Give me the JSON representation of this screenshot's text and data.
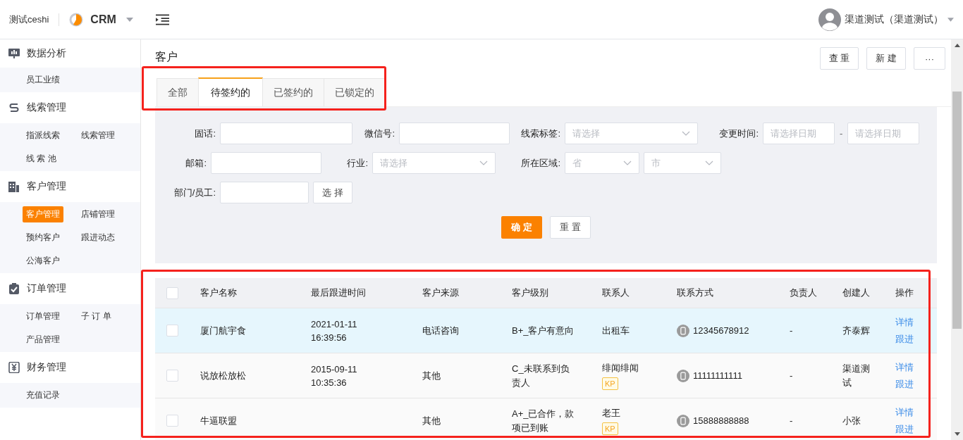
{
  "header": {
    "workspace": "测试ceshi",
    "app": "CRM",
    "user": "渠道测试（渠道测试）"
  },
  "sidebar": {
    "groups": [
      {
        "title": "数据分析",
        "items": [
          {
            "label": "员工业绩",
            "selected": false
          }
        ]
      },
      {
        "title": "线索管理",
        "items": [
          {
            "label": "指派线索",
            "selected": false
          },
          {
            "label": "线索管理",
            "selected": false
          },
          {
            "label": "线 索 池",
            "selected": false
          }
        ]
      },
      {
        "title": "客户管理",
        "items": [
          {
            "label": "客户管理",
            "selected": true
          },
          {
            "label": "店铺管理",
            "selected": false
          },
          {
            "label": "预约客户",
            "selected": false
          },
          {
            "label": "跟进动态",
            "selected": false
          },
          {
            "label": "公海客户",
            "selected": false
          }
        ]
      },
      {
        "title": "订单管理",
        "items": [
          {
            "label": "订单管理",
            "selected": false
          },
          {
            "label": "子 订 单",
            "selected": false
          },
          {
            "label": "产品管理",
            "selected": false
          }
        ]
      },
      {
        "title": "财务管理",
        "items": [
          {
            "label": "充值记录",
            "selected": false
          }
        ]
      }
    ]
  },
  "page": {
    "title": "客户",
    "buttons": [
      "查 重",
      "新 建",
      "···"
    ]
  },
  "tabs": [
    {
      "label": "全部",
      "selected": false
    },
    {
      "label": "待签约的",
      "selected": true
    },
    {
      "label": "已签约的",
      "selected": false
    },
    {
      "label": "已锁定的",
      "selected": false
    }
  ],
  "filters": {
    "rows": [
      [
        {
          "label": "固话:",
          "kind": "input"
        },
        {
          "label": "微信号:",
          "kind": "input"
        },
        {
          "label": "线索标签:",
          "kind": "select",
          "placeholder": "请选择"
        },
        {
          "label": "变更时间:",
          "kind": "date-range",
          "placeholder": "请选择日期",
          "placeholder_end": "请选择日期",
          "separator": "-"
        }
      ],
      [
        {
          "label": "邮箱:",
          "kind": "input"
        },
        {
          "label": "行业:",
          "kind": "select",
          "placeholder": "请选择"
        },
        {
          "label": "所在区域:",
          "kind": "region",
          "placeholder": "省",
          "placeholder_end": "市"
        }
      ],
      [
        {
          "label": "部门/员工:",
          "kind": "picker",
          "button": "选 择"
        }
      ]
    ],
    "confirm": "确 定",
    "reset": "重 置"
  },
  "table": {
    "all_checked": false,
    "columns": [
      "客户名称",
      "最后跟进时间",
      "客户来源",
      "客户级别",
      "联系人",
      "联系方式",
      "负责人",
      "创建人",
      "操作"
    ],
    "rows": [
      {
        "checked": false,
        "selected": true,
        "name": "厦门航宇食",
        "date": "2021-01-11",
        "time": "16:39:56",
        "source": "电话咨询",
        "level_text": "B+_客户有意向",
        "contact": "出租车",
        "kp": false,
        "phone": "12345678912",
        "owner": "-",
        "creator": "齐泰辉",
        "actions": [
          "详情",
          "跟进"
        ]
      },
      {
        "checked": false,
        "selected": false,
        "name": "说放松放松",
        "date": "2015-09-11",
        "time": "10:35:36",
        "source": "其他",
        "level_text": "C_未联系到负责人",
        "contact": "绯闻绯闻",
        "kp": true,
        "kp_label": "KP",
        "phone": "11111111111",
        "owner": "-",
        "creator": "渠道测试",
        "actions": [
          "详情",
          "跟进"
        ]
      },
      {
        "checked": false,
        "selected": false,
        "name": "牛逼联盟",
        "source": "其他",
        "level_text": "A+_已合作，款项已到账",
        "contact": "老王",
        "kp": true,
        "kp_label": "KP",
        "phone": "15888888888",
        "owner": "-",
        "creator": "小张",
        "actions": [
          "详情",
          "跟进"
        ]
      }
    ]
  }
}
